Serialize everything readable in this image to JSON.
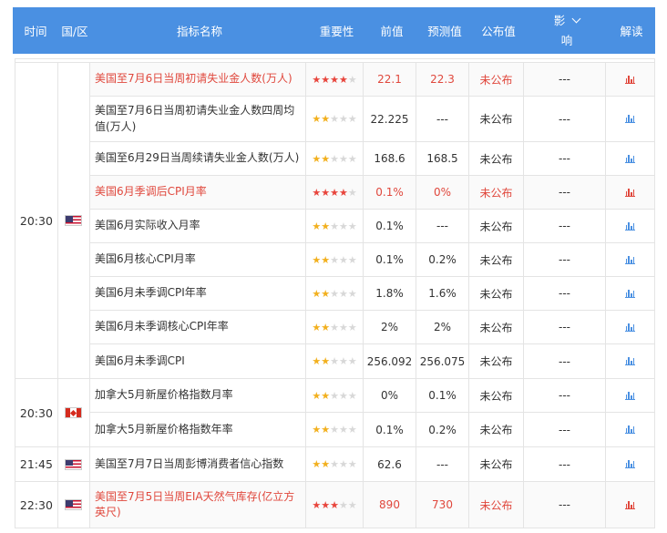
{
  "header": {
    "time": "时间",
    "country": "国/区",
    "indicator": "指标名称",
    "importance": "重要性",
    "previous": "前值",
    "forecast": "预测值",
    "actual": "公布值",
    "impact_line1": "影",
    "impact_line2": "响",
    "interpret": "解读"
  },
  "colors": {
    "header_bg": "#4a90e2",
    "highlight_text": "#e0483d",
    "star_red": "#e8453c",
    "star_yellow": "#f2b01e"
  },
  "groups": [
    {
      "time": "20:30",
      "country": "US",
      "flag_icon": "us-flag-icon",
      "rows": [
        {
          "name": "美国至7月6日当周初请失业金人数(万人)",
          "stars": 4,
          "prev": "22.1",
          "forecast": "22.3",
          "actual": "未公布",
          "impact": "---",
          "highlight": true
        },
        {
          "name": "美国至7月6日当周初请失业金人数四周均值(万人)",
          "stars": 2,
          "prev": "22.225",
          "forecast": "---",
          "actual": "未公布",
          "impact": "---",
          "highlight": false
        },
        {
          "name": "美国至6月29日当周续请失业金人数(万人)",
          "stars": 2,
          "prev": "168.6",
          "forecast": "168.5",
          "actual": "未公布",
          "impact": "---",
          "highlight": false
        },
        {
          "name": "美国6月季调后CPI月率",
          "stars": 4,
          "prev": "0.1%",
          "forecast": "0%",
          "actual": "未公布",
          "impact": "---",
          "highlight": true
        },
        {
          "name": "美国6月实际收入月率",
          "stars": 2,
          "prev": "0.1%",
          "forecast": "---",
          "actual": "未公布",
          "impact": "---",
          "highlight": false
        },
        {
          "name": "美国6月核心CPI月率",
          "stars": 2,
          "prev": "0.1%",
          "forecast": "0.2%",
          "actual": "未公布",
          "impact": "---",
          "highlight": false
        },
        {
          "name": "美国6月未季调CPI年率",
          "stars": 2,
          "prev": "1.8%",
          "forecast": "1.6%",
          "actual": "未公布",
          "impact": "---",
          "highlight": false
        },
        {
          "name": "美国6月未季调核心CPI年率",
          "stars": 2,
          "prev": "2%",
          "forecast": "2%",
          "actual": "未公布",
          "impact": "---",
          "highlight": false
        },
        {
          "name": "美国6月未季调CPI",
          "stars": 2,
          "prev": "256.092",
          "forecast": "256.075",
          "actual": "未公布",
          "impact": "---",
          "highlight": false
        }
      ]
    },
    {
      "time": "20:30",
      "country": "CA",
      "flag_icon": "canada-flag-icon",
      "rows": [
        {
          "name": "加拿大5月新屋价格指数月率",
          "stars": 2,
          "prev": "0%",
          "forecast": "0.1%",
          "actual": "未公布",
          "impact": "---",
          "highlight": false
        },
        {
          "name": "加拿大5月新屋价格指数年率",
          "stars": 2,
          "prev": "0.1%",
          "forecast": "0.2%",
          "actual": "未公布",
          "impact": "---",
          "highlight": false
        }
      ]
    },
    {
      "time": "21:45",
      "country": "US",
      "flag_icon": "us-flag-icon",
      "rows": [
        {
          "name": "美国至7月7日当周彭博消费者信心指数",
          "stars": 2,
          "prev": "62.6",
          "forecast": "---",
          "actual": "未公布",
          "impact": "---",
          "highlight": false
        }
      ]
    },
    {
      "time": "22:30",
      "country": "US",
      "flag_icon": "us-flag-icon",
      "rows": [
        {
          "name": "美国至7月5日当周EIA天然气库存(亿立方英尺)",
          "stars": 3,
          "prev": "890",
          "forecast": "730",
          "actual": "未公布",
          "impact": "---",
          "highlight": true
        }
      ]
    }
  ]
}
